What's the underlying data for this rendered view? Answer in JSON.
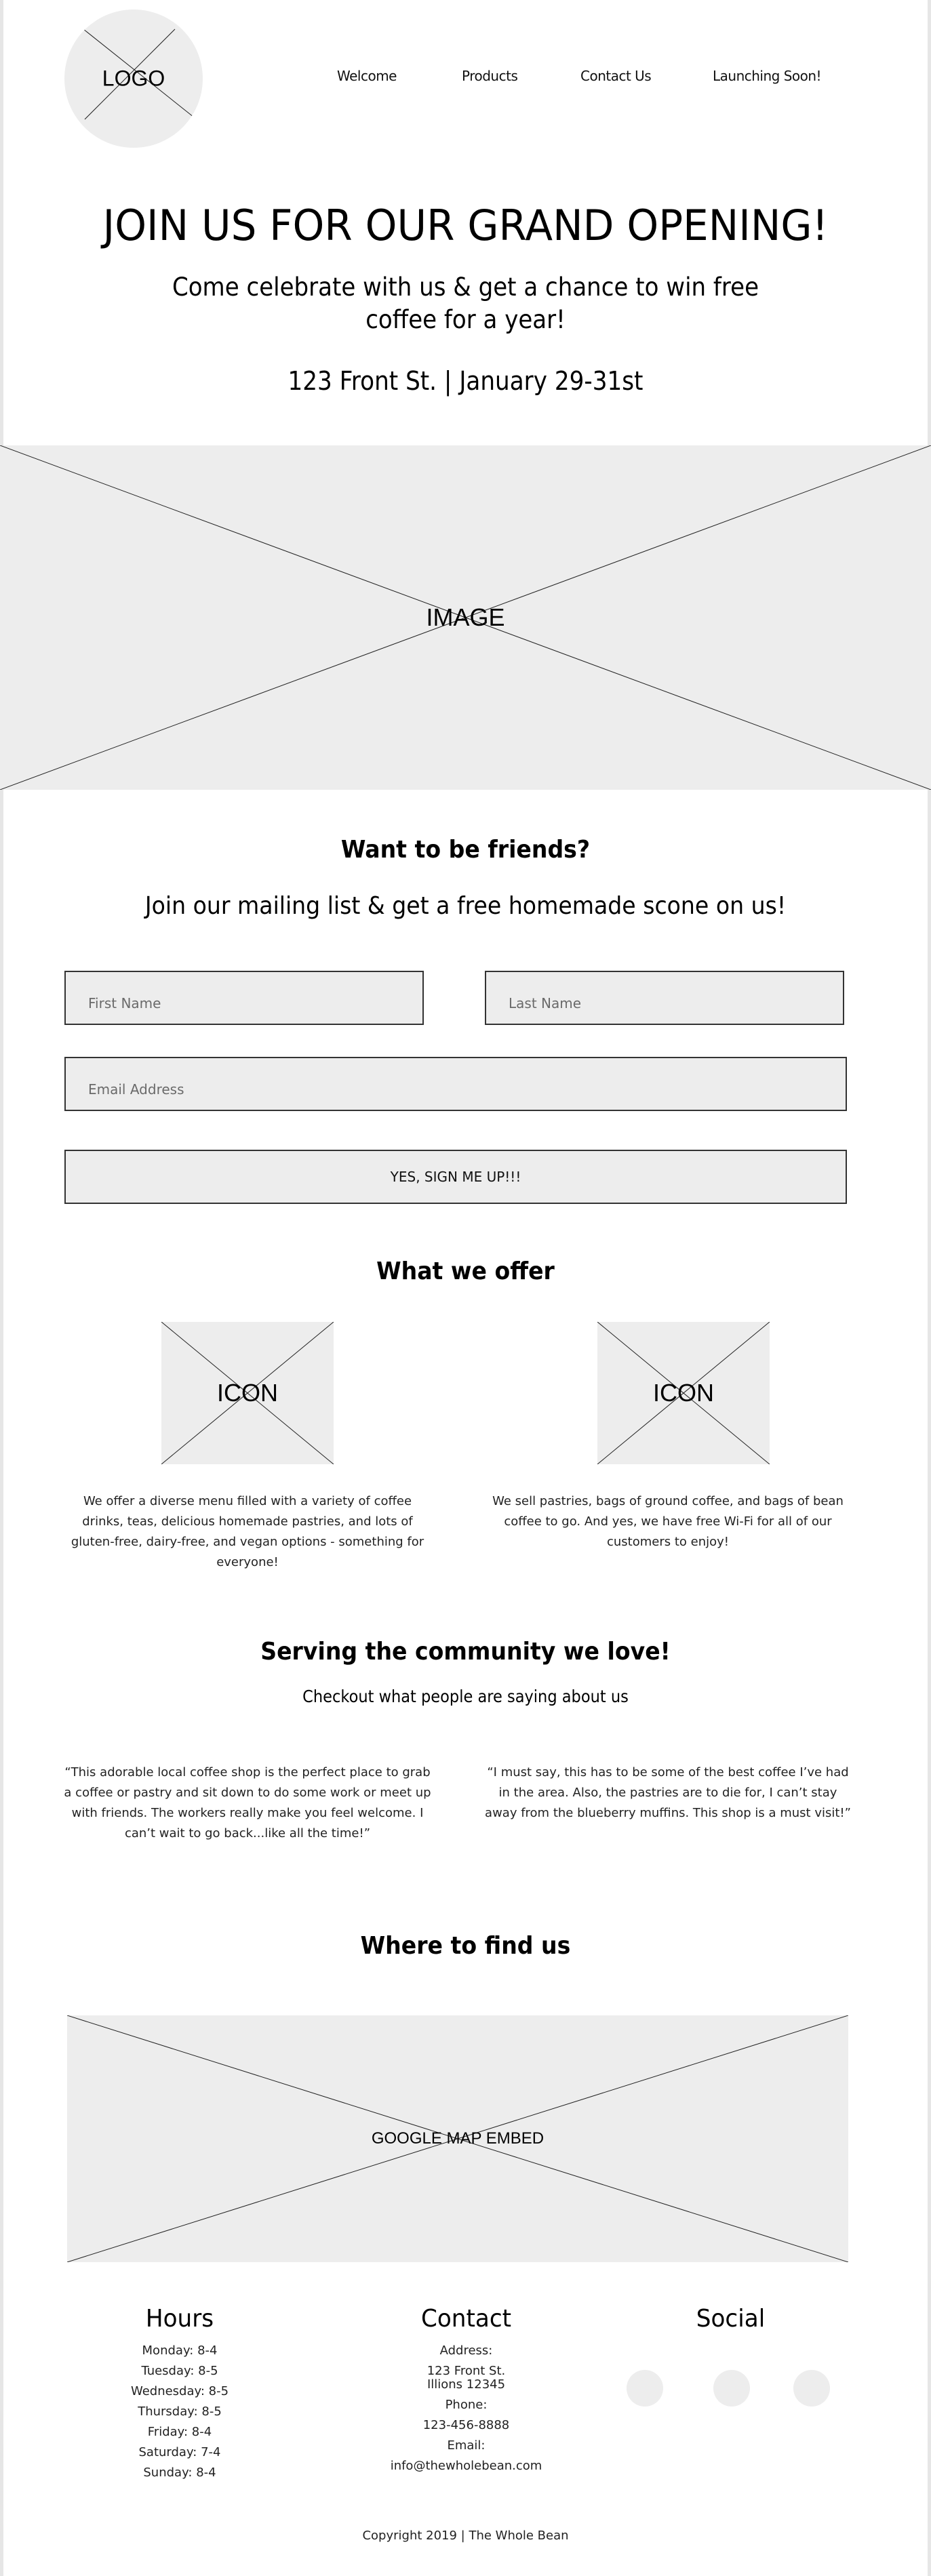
{
  "header": {
    "logo_label": "LOGO",
    "nav": [
      {
        "label": "Welcome"
      },
      {
        "label": "Products"
      },
      {
        "label": "Contact Us"
      },
      {
        "label": "Launching Soon!"
      }
    ]
  },
  "hero": {
    "title": "JOIN US FOR OUR GRAND OPENING!",
    "subtitle": "Come celebrate with us & get a chance to win free coffee for a year!",
    "location_date": "123 Front St. | January 29-31st",
    "image_label": "IMAGE"
  },
  "signup": {
    "heading": "Want to be friends?",
    "subheading": "Join our mailing list & get a free homemade scone on us!",
    "first_name_placeholder": "First Name",
    "last_name_placeholder": "Last Name",
    "email_placeholder": "Email Address",
    "submit_label": "YES, SIGN ME UP!!!"
  },
  "offer": {
    "heading": "What we offer",
    "items": [
      {
        "icon_label": "ICON",
        "text": "We offer a diverse menu filled with a variety of coffee drinks, teas, delicious homemade pastries, and lots of gluten-free, dairy-free, and vegan options - something for everyone!"
      },
      {
        "icon_label": "ICON",
        "text": "We sell pastries, bags of ground coffee, and bags of bean coffee to go. And yes, we have free Wi-Fi for all of our customers to enjoy!"
      }
    ]
  },
  "community": {
    "heading": "Serving the community we love!",
    "subheading": "Checkout what people are saying about us",
    "testimonials": [
      {
        "text": "“This adorable local coffee shop is the perfect place to grab a coffee or pastry and sit down to do some work or meet up with friends. The workers really make you feel welcome. I can’t wait to go back...like all the time!”"
      },
      {
        "text": "“I must say, this has to be some of the best coffee I’ve had in the area. Also, the pastries are to die for, I can’t stay away from the blueberry muffins. This shop is a must visit!”"
      }
    ]
  },
  "location": {
    "heading": "Where to find us",
    "map_label": "GOOGLE MAP EMBED"
  },
  "footer": {
    "hours": {
      "heading": "Hours",
      "days": [
        "Monday: 8-4",
        "Tuesday: 8-5",
        "Wednesday: 8-5",
        "Thursday: 8-5",
        "Friday: 8-4",
        "Saturday: 7-4",
        "Sunday: 8-4"
      ]
    },
    "contact": {
      "heading": "Contact",
      "address_label": "Address:",
      "address_line1": "123 Front St.",
      "address_line2": "Illions 12345",
      "phone_label": "Phone:",
      "phone": "123-456-8888",
      "email_label": "Email:",
      "email": "info@thewholebean.com"
    },
    "social": {
      "heading": "Social",
      "icons": [
        "social-icon-1",
        "social-icon-2",
        "social-icon-3"
      ]
    },
    "copyright": "Copyright 2019 | The Whole Bean"
  },
  "colors": {
    "placeholder_fill": "#ededed",
    "border": "#333333",
    "frame": "#e6e6e6",
    "text": "#000000"
  }
}
